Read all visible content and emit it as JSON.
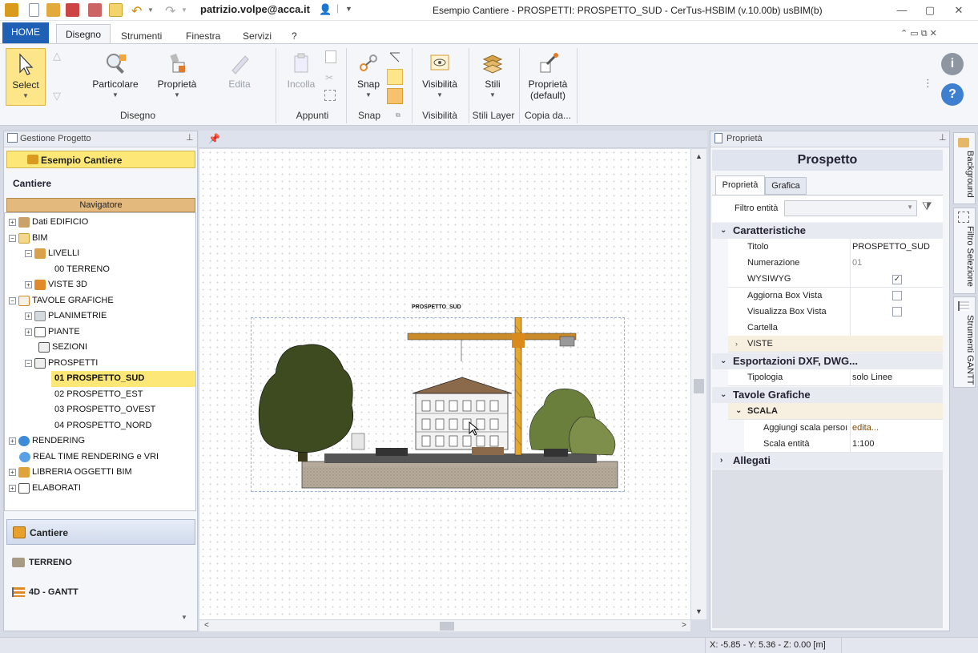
{
  "titlebar": {
    "user": "patrizio.volpe@acca.it",
    "title": "Esempio Cantiere -  PROSPETTI: PROSPETTO_SUD - CerTus-HSBIM (v.10.00b) usBIM(b)"
  },
  "tabs": {
    "home": "HOME",
    "disegno": "Disegno",
    "strumenti": "Strumenti",
    "finestra": "Finestra",
    "servizi": "Servizi",
    "help": "?"
  },
  "ribbon": {
    "select": "Select",
    "particolare": "Particolare",
    "proprieta": "Proprietà",
    "edita": "Edita",
    "incolla": "Incolla",
    "snap": "Snap",
    "visibilita": "Visibilità",
    "stili": "Stili",
    "proprieta_default_1": "Proprietà",
    "proprieta_default_2": "(default)",
    "groups": {
      "disegno": "Disegno",
      "appunti": "Appunti",
      "snap": "Snap",
      "visibilita": "Visibilità",
      "stili_layer": "Stili Layer",
      "copia_da": "Copia da..."
    }
  },
  "left": {
    "panel_title": "Gestione Progetto",
    "project_name": "Esempio Cantiere",
    "section": "Cantiere",
    "navigator": "Navigatore",
    "tree": [
      "Dati EDIFICIO",
      "BIM",
      "LIVELLI",
      "00 TERRENO",
      "VISTE 3D",
      "TAVOLE GRAFICHE",
      "PLANIMETRIE",
      "PIANTE",
      "SEZIONI",
      "PROSPETTI",
      "01 PROSPETTO_SUD",
      "02 PROSPETTO_EST",
      "03 PROSPETTO_OVEST",
      "04 PROSPETTO_NORD",
      "RENDERING",
      "REAL TIME RENDERING e VRI",
      "LIBRERIA OGGETTI BIM",
      "ELABORATI"
    ],
    "bottom_nav": {
      "cantiere": "Cantiere",
      "terreno": "TERRENO",
      "gantt": "4D - GANTT"
    }
  },
  "canvas": {
    "drawing_label": "PROSPETTO_SUD"
  },
  "right": {
    "panel_title": "Proprietà",
    "header": "Prospetto",
    "tab_proprieta": "Proprietà",
    "tab_grafica": "Grafica",
    "filter_label": "Filtro entità",
    "cat_caratteristiche": "Caratteristiche",
    "titolo_label": "Titolo",
    "titolo_value": "PROSPETTO_SUD",
    "numerazione_label": "Numerazione",
    "numerazione_value": "01",
    "wysiwyg_label": "WYSIWYG",
    "aggiorna_label": "Aggiorna Box Vista",
    "visualizza_label": "Visualizza Box Vista",
    "cartella_label": "Cartella",
    "viste_label": "VISTE",
    "cat_esportazioni": "Esportazioni DXF, DWG...",
    "tipologia_label": "Tipologia",
    "tipologia_value": "solo Linee",
    "cat_tavole": "Tavole Grafiche",
    "scala_label": "SCALA",
    "aggiungi_label": "Aggiungi scala persoı",
    "aggiungi_value": "edita...",
    "scala_entita_label": "Scala entità",
    "scala_entita_value": "1:100",
    "cat_allegati": "Allegati"
  },
  "sidebar": {
    "background": "Background",
    "filtro": "Filtro Selezione",
    "gantt": "Strumenti GANTT"
  },
  "status": {
    "coords": "X: -5.85 - Y: 5.36 - Z: 0.00 [m]"
  },
  "colors": {
    "accent": "#1f5fb4",
    "selected_bg": "#ffe87c",
    "category_bg": "#e7eaf1",
    "highlight_row": "#f7efe0"
  }
}
